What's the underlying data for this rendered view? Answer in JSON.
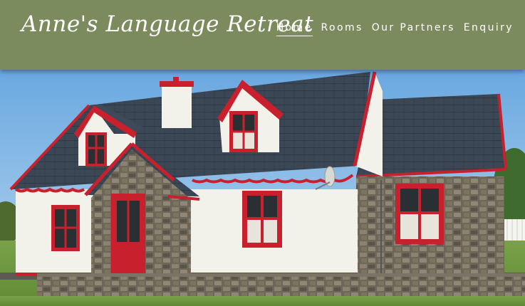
{
  "site": {
    "logo_text": "Anne's Language Retreat"
  },
  "nav": {
    "items": [
      {
        "label": "Home",
        "active": true
      },
      {
        "label": "Rooms",
        "active": false
      },
      {
        "label": "Our Partners",
        "active": false
      },
      {
        "label": "Enquiry",
        "active": false
      }
    ]
  },
  "colors": {
    "header_bg": "#7c8b5e",
    "accent_red": "#c8202c",
    "wall_white": "#f2f1ea",
    "roof_slate": "#3d4a59",
    "sky": "#7fb7e6"
  },
  "hero": {
    "subject": "cottage-photo"
  }
}
